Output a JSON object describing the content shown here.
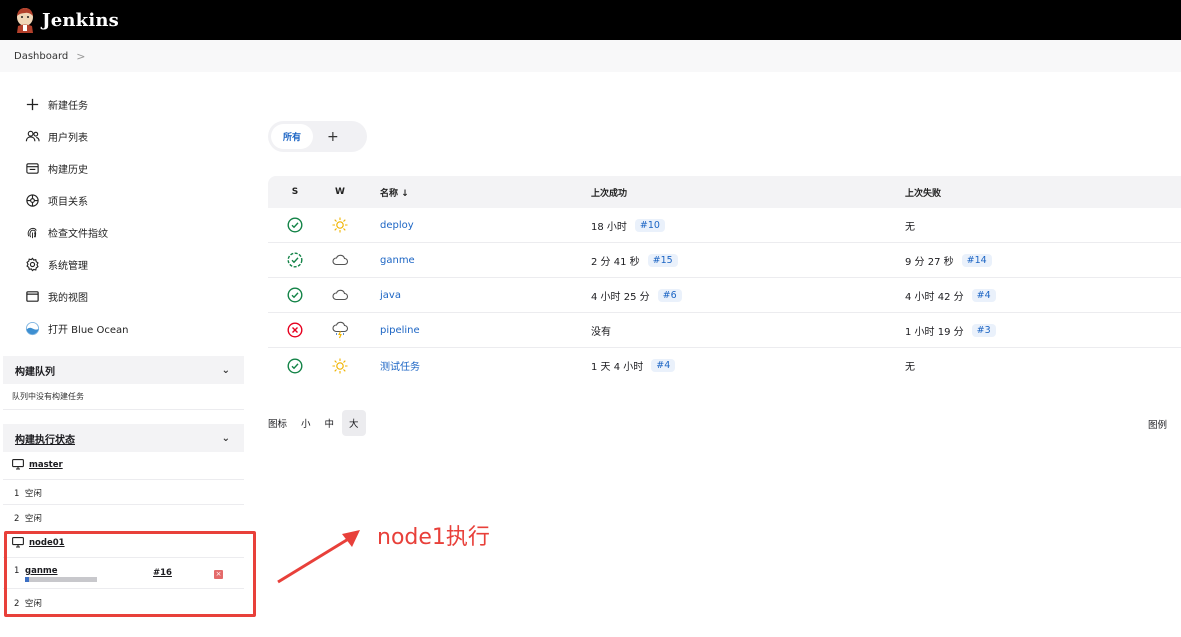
{
  "header": {
    "title": "Jenkins"
  },
  "breadcrumb": {
    "items": [
      "Dashboard"
    ],
    "separator": ">"
  },
  "sidebar": {
    "tasks": [
      {
        "label": "新建任务",
        "icon": "plus-icon"
      },
      {
        "label": "用户列表",
        "icon": "users-icon"
      },
      {
        "label": "构建历史",
        "icon": "history-icon"
      },
      {
        "label": "项目关系",
        "icon": "relationship-icon"
      },
      {
        "label": "检查文件指纹",
        "icon": "fingerprint-icon"
      },
      {
        "label": "系统管理",
        "icon": "gear-icon"
      },
      {
        "label": "我的视图",
        "icon": "window-icon"
      },
      {
        "label": "打开 Blue Ocean",
        "icon": "blue-ocean-icon"
      }
    ],
    "build_queue": {
      "title": "构建队列",
      "empty_text": "队列中没有构建任务"
    },
    "executors": {
      "title": "构建执行状态",
      "nodes": [
        {
          "name": "master",
          "rows": [
            {
              "num": "1",
              "status": "空闲"
            },
            {
              "num": "2",
              "status": "空闲"
            }
          ]
        },
        {
          "name": "node01",
          "busy": {
            "num": "1",
            "job": "ganme",
            "build": "#16",
            "progress": 0.05
          },
          "rows": [
            {
              "num": "2",
              "status": "空闲"
            }
          ]
        }
      ]
    }
  },
  "annotation": {
    "text": "node1执行",
    "color": "#e8403a"
  },
  "views": {
    "active": "所有",
    "add": "+"
  },
  "table": {
    "headers": {
      "s": "S",
      "w": "W",
      "name": "名称 ↓",
      "last_success": "上次成功",
      "last_failure": "上次失败"
    },
    "rows": [
      {
        "status": "success",
        "weather": "sunny",
        "name": "deploy",
        "success_time": "18 小时",
        "success_build": "#10",
        "failure_time": "无",
        "failure_build": ""
      },
      {
        "status": "success-running",
        "weather": "cloudy",
        "name": "ganme",
        "success_time": "2 分 41 秒",
        "success_build": "#15",
        "failure_time": "9 分 27 秒",
        "failure_build": "#14"
      },
      {
        "status": "success",
        "weather": "cloudy",
        "name": "java",
        "success_time": "4 小时 25 分",
        "success_build": "#6",
        "failure_time": "4 小时 42 分",
        "failure_build": "#4"
      },
      {
        "status": "failed",
        "weather": "storm",
        "name": "pipeline",
        "success_time": "没有",
        "success_build": "",
        "failure_time": "1 小时 19 分",
        "failure_build": "#3"
      },
      {
        "status": "success",
        "weather": "sunny",
        "name": "测试任务",
        "success_time": "1 天 4 小时",
        "success_build": "#4",
        "failure_time": "无",
        "failure_build": ""
      }
    ]
  },
  "icon_size": {
    "label": "图标",
    "options": [
      "小",
      "中",
      "大"
    ],
    "selected": "大"
  },
  "legend": {
    "label": "图例"
  },
  "colors": {
    "link": "#1c65c4",
    "success": "#138347",
    "failure": "#e6001f",
    "sunny": "#f0b400"
  }
}
